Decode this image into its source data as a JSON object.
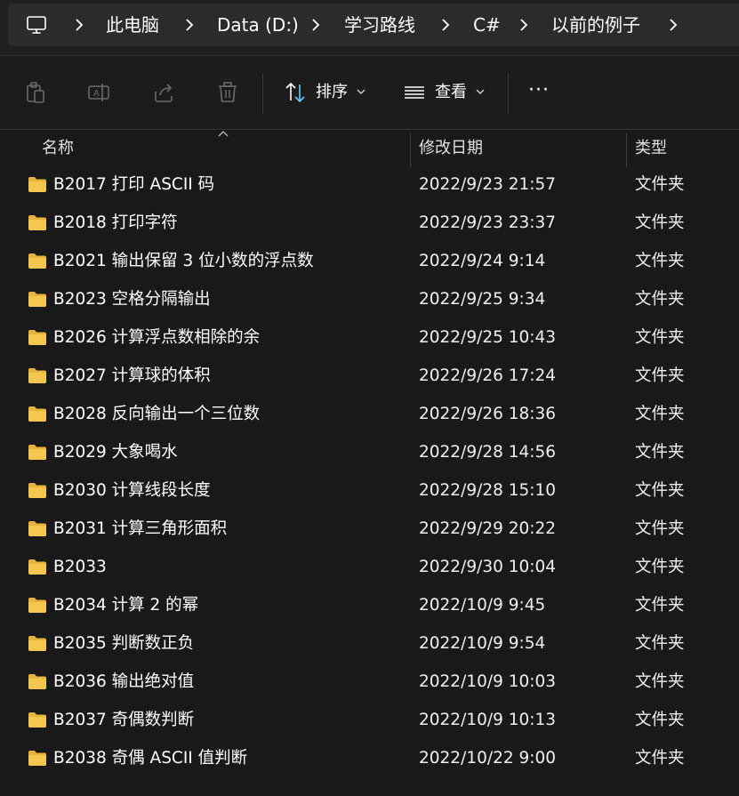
{
  "address_bar": {
    "icon": "computer-icon",
    "crumbs": [
      "此电脑",
      "Data (D:)",
      "学习路线",
      "C#",
      "以前的例子"
    ]
  },
  "toolbar": {
    "icons": [
      "paste-icon",
      "rename-icon",
      "share-icon",
      "delete-icon"
    ],
    "sort_label": "排序",
    "view_label": "查看",
    "more_label": "···"
  },
  "columns": {
    "name": "名称",
    "date": "修改日期",
    "type": "类型"
  },
  "rows": [
    {
      "name": "B2017 打印 ASCII 码",
      "date": "2022/9/23 21:57",
      "type": "文件夹"
    },
    {
      "name": "B2018 打印字符",
      "date": "2022/9/23 23:37",
      "type": "文件夹"
    },
    {
      "name": "B2021 输出保留 3 位小数的浮点数",
      "date": "2022/9/24 9:14",
      "type": "文件夹"
    },
    {
      "name": "B2023 空格分隔输出",
      "date": "2022/9/25 9:34",
      "type": "文件夹"
    },
    {
      "name": "B2026 计算浮点数相除的余",
      "date": "2022/9/25 10:43",
      "type": "文件夹"
    },
    {
      "name": "B2027 计算球的体积",
      "date": "2022/9/26 17:24",
      "type": "文件夹"
    },
    {
      "name": "B2028 反向输出一个三位数",
      "date": "2022/9/26 18:36",
      "type": "文件夹"
    },
    {
      "name": "B2029 大象喝水",
      "date": "2022/9/28 14:56",
      "type": "文件夹"
    },
    {
      "name": "B2030 计算线段长度",
      "date": "2022/9/28 15:10",
      "type": "文件夹"
    },
    {
      "name": "B2031 计算三角形面积",
      "date": "2022/9/29 20:22",
      "type": "文件夹"
    },
    {
      "name": "B2033",
      "date": "2022/9/30 10:04",
      "type": "文件夹"
    },
    {
      "name": "B2034 计算 2 的幂",
      "date": "2022/10/9 9:45",
      "type": "文件夹"
    },
    {
      "name": "B2035 判断数正负",
      "date": "2022/10/9 9:54",
      "type": "文件夹"
    },
    {
      "name": "B2036 输出绝对值",
      "date": "2022/10/9 10:03",
      "type": "文件夹"
    },
    {
      "name": "B2037 奇偶数判断",
      "date": "2022/10/9 10:13",
      "type": "文件夹"
    },
    {
      "name": "B2038 奇偶 ASCII 值判断",
      "date": "2022/10/22 9:00",
      "type": "文件夹"
    }
  ],
  "colors": {
    "background": "#191919",
    "address_bg": "#2b2b2b",
    "folder": "#f3c74f",
    "accent_sort": "#60cdff"
  }
}
